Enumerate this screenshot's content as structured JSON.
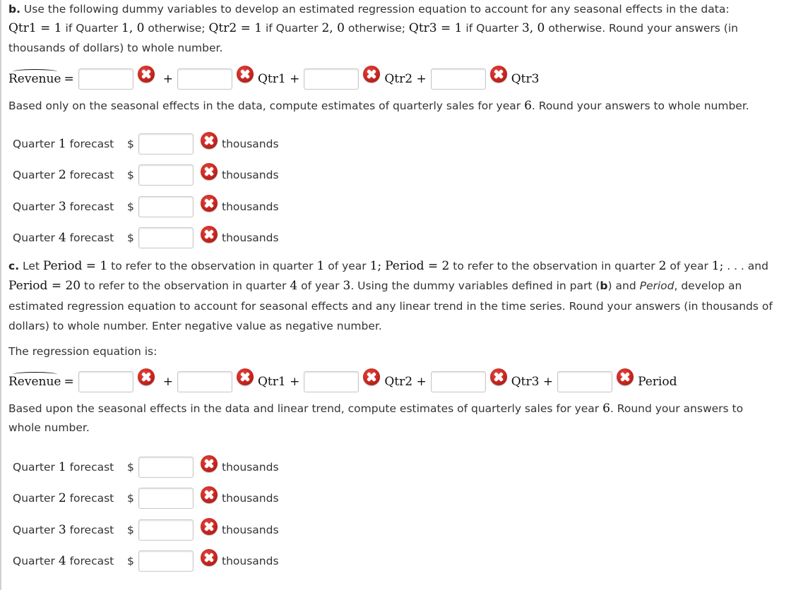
{
  "part_b": {
    "label": "b.",
    "intro": " Use the following dummy variables to develop an estimated regression equation to account for any seasonal effects in the data:",
    "def": {
      "qtr1": "Qtr1 = 1",
      "t1": " if Quarter ",
      "n1": "1, 0",
      "t2": " otherwise; ",
      "qtr2": "Qtr2 = 1",
      "t3": " if Quarter ",
      "n2": "2, 0",
      "t4": " otherwise; ",
      "qtr3": "Qtr3 = 1",
      "t5": " if Quarter ",
      "n3": "3, 0",
      "t6": " otherwise. Round your answers (in"
    },
    "intro_end": "thousands of dollars) to whole number.",
    "equation": {
      "lhs": "Revenue",
      "eq": "=",
      "plus": "+",
      "terms": [
        "Qtr1 +",
        "Qtr2 +",
        "Qtr3"
      ],
      "inputs": [
        "",
        "",
        "",
        ""
      ]
    },
    "forecast_intro_a": "Based only on the seasonal effects in the data, compute estimates of quarterly sales for year ",
    "forecast_year": "6",
    "forecast_intro_b": ". Round your answers to whole number.",
    "forecasts": [
      {
        "pre": "Quarter ",
        "q": "1",
        "post": " forecast",
        "currency": "$",
        "value": "",
        "unit": "thousands",
        "status": "incorrect"
      },
      {
        "pre": "Quarter ",
        "q": "2",
        "post": " forecast",
        "currency": "$",
        "value": "",
        "unit": "thousands",
        "status": "incorrect"
      },
      {
        "pre": "Quarter ",
        "q": "3",
        "post": " forecast",
        "currency": "$",
        "value": "",
        "unit": "thousands",
        "status": "incorrect"
      },
      {
        "pre": "Quarter ",
        "q": "4",
        "post": " forecast",
        "currency": "$",
        "value": "",
        "unit": "thousands",
        "status": "incorrect"
      }
    ]
  },
  "part_c": {
    "label": "c.",
    "l1": {
      "a": " Let ",
      "m1": "Period = 1",
      "b": " to refer to the observation in quarter ",
      "m2": "1",
      "c": " of year ",
      "m3": "1;",
      "d": " ",
      "m4": "Period = 2",
      "e": " to refer to the observation in quarter ",
      "m5": "2",
      "f": " of year ",
      "m6": "1;",
      "g": " . . . and"
    },
    "l2": {
      "m1": "Period = 20",
      "a": " to refer to the observation in quarter ",
      "m2": "4",
      "b": " of year ",
      "m3": "3",
      "c": ". Using the dummy variables defined in part (",
      "bold": "b",
      "d": ") and ",
      "ital": "Period",
      "e": ", develop an"
    },
    "l3": "estimated regression equation to account for seasonal effects and any linear trend in the time series. Round your answers (in thousands of",
    "l4": "dollars) to whole number. Enter negative value as negative number.",
    "eq_label": "The regression equation is:",
    "equation": {
      "lhs": "Revenue",
      "eq": "=",
      "plus": "+",
      "terms": [
        "Qtr1 +",
        "Qtr2 +",
        "Qtr3 +",
        "Period"
      ],
      "inputs": [
        "",
        "",
        "",
        "",
        ""
      ]
    },
    "forecast_intro_a": "Based upon the seasonal effects in the data and linear trend, compute estimates of quarterly sales for year ",
    "forecast_year": "6",
    "forecast_intro_b": ". Round your answers to",
    "forecast_intro_c": "whole number.",
    "forecasts": [
      {
        "pre": "Quarter ",
        "q": "1",
        "post": " forecast",
        "currency": "$",
        "value": "",
        "unit": "thousands",
        "status": "incorrect"
      },
      {
        "pre": "Quarter ",
        "q": "2",
        "post": " forecast",
        "currency": "$",
        "value": "",
        "unit": "thousands",
        "status": "incorrect"
      },
      {
        "pre": "Quarter ",
        "q": "3",
        "post": " forecast",
        "currency": "$",
        "value": "",
        "unit": "thousands",
        "status": "incorrect"
      },
      {
        "pre": "Quarter ",
        "q": "4",
        "post": " forecast",
        "currency": "$",
        "value": "",
        "unit": "thousands",
        "status": "incorrect"
      }
    ]
  },
  "colors": {
    "incorrect_icon": "#c7261f",
    "text": "#333333",
    "border": "#d0d0d0"
  }
}
